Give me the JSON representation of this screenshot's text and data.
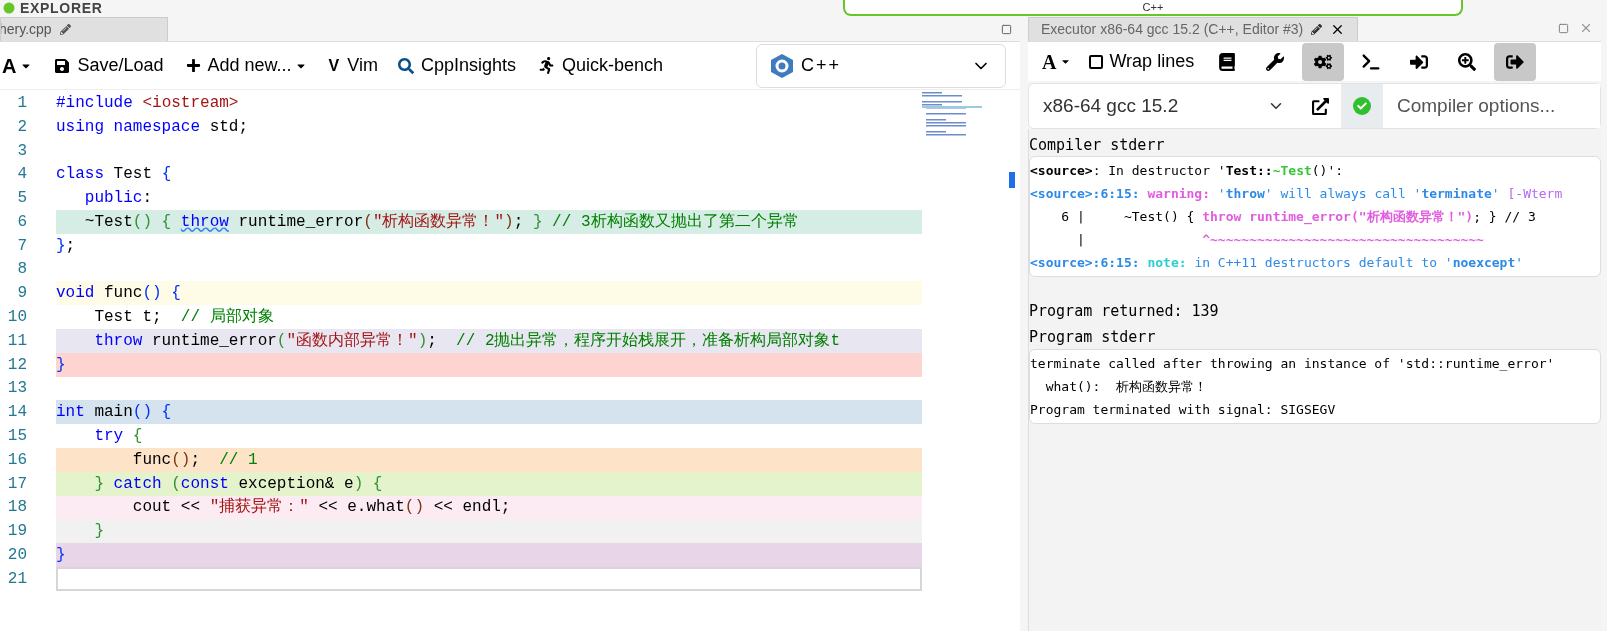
{
  "logo": {
    "text": "EXPLORER"
  },
  "top_language": {
    "text": "C++"
  },
  "editor": {
    "tab": {
      "title": "hery.cpp"
    },
    "toolbar": [
      {
        "kind": "font",
        "label": "A"
      },
      {
        "kind": "save",
        "label": "Save/Load"
      },
      {
        "kind": "add",
        "label": "Add new..."
      },
      {
        "kind": "vim",
        "icon_text": "V",
        "label": "Vim"
      },
      {
        "kind": "insights",
        "label": "CppInsights"
      },
      {
        "kind": "bench",
        "label": "Quick-bench"
      }
    ],
    "language": "C++",
    "lines": [
      {
        "number": "1",
        "color": "#ffffff",
        "current": false,
        "tokens": [
          {
            "kind": "kw",
            "text": "#include "
          },
          {
            "kind": "str",
            "text": "<iostream>"
          }
        ]
      },
      {
        "number": "2",
        "color": "#ffffff",
        "current": false,
        "tokens": [
          {
            "kind": "kw",
            "text": "using namespace "
          },
          {
            "kind": "txt",
            "text": "std;"
          }
        ]
      },
      {
        "number": "3",
        "current": false
      },
      {
        "number": "4",
        "color": "#ffffff",
        "current": false,
        "tokens": [
          {
            "kind": "kw",
            "text": "class "
          },
          {
            "kind": "txt",
            "text": "Test "
          },
          {
            "kind": "b1",
            "text": "{"
          }
        ]
      },
      {
        "number": "5",
        "color": "#ffffff",
        "current": false,
        "tokens": [
          {
            "kind": "kw",
            "text": "   public"
          },
          {
            "kind": "txt",
            "text": ":"
          }
        ]
      },
      {
        "number": "6",
        "color": "#d6ede6",
        "current": false,
        "tokens": [
          {
            "kind": "txt",
            "text": "   ~Test"
          },
          {
            "kind": "b2",
            "text": "() { "
          },
          {
            "kind": "kwerr",
            "text": "throw"
          },
          {
            "kind": "txt",
            "text": " runtime_error"
          },
          {
            "kind": "b3",
            "text": "("
          },
          {
            "kind": "str",
            "text": "\"析构函数异常！\""
          },
          {
            "kind": "b3",
            "text": ")"
          },
          {
            "kind": "txt",
            "text": "; "
          },
          {
            "kind": "b2",
            "text": "}"
          },
          {
            "kind": "cmt",
            "text": " // 3析构函数又抛出了第二个异常"
          }
        ]
      },
      {
        "number": "7",
        "color": "#ffffff",
        "current": false,
        "tokens": [
          {
            "kind": "b1",
            "text": "}"
          },
          {
            "kind": "txt",
            "text": ";"
          }
        ]
      },
      {
        "number": "8",
        "current": false
      },
      {
        "number": "9",
        "color": "#fefbe6",
        "current": false,
        "tokens": [
          {
            "kind": "kw",
            "text": "void "
          },
          {
            "kind": "txt",
            "text": "func"
          },
          {
            "kind": "b1",
            "text": "() {"
          }
        ]
      },
      {
        "number": "10",
        "color": "#ffffff",
        "current": false,
        "tokens": [
          {
            "kind": "txt",
            "text": "    Test t;  "
          },
          {
            "kind": "cmt",
            "text": "// 局部对象"
          }
        ]
      },
      {
        "number": "11",
        "color": "#e8e6f1",
        "current": false,
        "tokens": [
          {
            "kind": "kw",
            "text": "    throw "
          },
          {
            "kind": "txt",
            "text": "runtime_error"
          },
          {
            "kind": "b2",
            "text": "("
          },
          {
            "kind": "str",
            "text": "\"函数内部异常！\""
          },
          {
            "kind": "b2",
            "text": ")"
          },
          {
            "kind": "txt",
            "text": ";  "
          },
          {
            "kind": "cmt",
            "text": "// 2抛出异常，程序开始栈展开，准备析构局部对象t"
          }
        ]
      },
      {
        "number": "12",
        "color": "#fdd4d0",
        "current": false,
        "tokens": [
          {
            "kind": "b1",
            "text": "}"
          }
        ]
      },
      {
        "number": "13",
        "current": false
      },
      {
        "number": "14",
        "color": "#d4e3ee",
        "current": false,
        "tokens": [
          {
            "kind": "kw",
            "text": "int "
          },
          {
            "kind": "txt",
            "text": "main"
          },
          {
            "kind": "b1",
            "text": "() {"
          }
        ]
      },
      {
        "number": "15",
        "color": "#ffffff",
        "current": false,
        "tokens": [
          {
            "kind": "kw",
            "text": "    try "
          },
          {
            "kind": "b2",
            "text": "{"
          }
        ]
      },
      {
        "number": "16",
        "color": "#fde3c8",
        "current": false,
        "tokens": [
          {
            "kind": "txt",
            "text": "        func"
          },
          {
            "kind": "b3",
            "text": "()"
          },
          {
            "kind": "txt",
            "text": ";  "
          },
          {
            "kind": "cmt",
            "text": "// 1"
          }
        ]
      },
      {
        "number": "17",
        "color": "#e4f3cc",
        "current": false,
        "tokens": [
          {
            "kind": "b2",
            "text": "    } "
          },
          {
            "kind": "kw",
            "text": "catch "
          },
          {
            "kind": "b2",
            "text": "("
          },
          {
            "kind": "kw",
            "text": "const "
          },
          {
            "kind": "txt",
            "text": "exception& e"
          },
          {
            "kind": "b2",
            "text": ") {"
          }
        ]
      },
      {
        "number": "18",
        "color": "#fdebf3",
        "current": false,
        "tokens": [
          {
            "kind": "txt",
            "text": "        cout << "
          },
          {
            "kind": "str",
            "text": "\"捕获异常：\""
          },
          {
            "kind": "txt",
            "text": " << e.what"
          },
          {
            "kind": "b3",
            "text": "()"
          },
          {
            "kind": "txt",
            "text": " << endl;"
          }
        ]
      },
      {
        "number": "19",
        "color": "#f1f1f1",
        "current": false,
        "tokens": [
          {
            "kind": "b2",
            "text": "    }"
          }
        ]
      },
      {
        "number": "20",
        "color": "#e9d5e8",
        "current": false,
        "tokens": [
          {
            "kind": "b1",
            "text": "}"
          }
        ]
      },
      {
        "number": "21",
        "color": "#ffffff",
        "current": true
      }
    ]
  },
  "executor": {
    "tab": {
      "title": "Executor x86-64 gcc 15.2 (C++, Editor #3)"
    },
    "toolbar": [
      {
        "kind": "font",
        "label": "A",
        "selected": false
      },
      {
        "kind": "wrap",
        "label": "Wrap lines",
        "checked": false,
        "selected": false
      },
      {
        "kind": "book",
        "selected": false
      },
      {
        "kind": "wrench",
        "selected": false
      },
      {
        "kind": "gears",
        "selected": true
      },
      {
        "kind": "terminal",
        "selected": false
      },
      {
        "kind": "signin",
        "selected": false
      },
      {
        "kind": "chart",
        "selected": false
      },
      {
        "kind": "signout",
        "selected": true
      }
    ],
    "compiler": "x86-64 gcc 15.2",
    "status_ok": true,
    "options_placeholder": "Compiler options...",
    "compiler_stderr_title": "Compiler stderr",
    "compiler_stderr": [
      [
        {
          "kind": "bold",
          "text": "<source>"
        },
        {
          "kind": "txt",
          "text": ": In destructor '"
        },
        {
          "kind": "bold",
          "text": "Test::"
        },
        {
          "kind": "greenbold",
          "text": "~Test"
        },
        {
          "kind": "txt",
          "text": "()':"
        }
      ],
      [
        {
          "kind": "bluebold",
          "text": "<source>:6:15: "
        },
        {
          "kind": "warn",
          "text": "warning: "
        },
        {
          "kind": "blue",
          "text": "'"
        },
        {
          "kind": "bluebold",
          "text": "throw"
        },
        {
          "kind": "blue",
          "text": "' will always call '"
        },
        {
          "kind": "bluebold",
          "text": "terminate"
        },
        {
          "kind": "blue",
          "text": "' "
        },
        {
          "kind": "magenta",
          "text": "[-Wterm"
        }
      ],
      [
        {
          "kind": "txt",
          "text": "    6 |     ~Test() { "
        },
        {
          "kind": "warn",
          "text": "throw runtime_error(\"析构函数异常！\")"
        },
        {
          "kind": "txt",
          "text": "; } // 3"
        }
      ],
      [
        {
          "kind": "txt",
          "text": "      |               "
        },
        {
          "kind": "warn",
          "text": "^~~~~~~~~~~~~~~~~~~~~~~~~~~~~~~~~~~~"
        }
      ],
      [
        {
          "kind": "bluebold",
          "text": "<source>:6:15: "
        },
        {
          "kind": "note",
          "text": "note: "
        },
        {
          "kind": "blue",
          "text": "in C++11 destructors default to '"
        },
        {
          "kind": "bluebold",
          "text": "noexcept"
        },
        {
          "kind": "blue",
          "text": "'"
        }
      ]
    ],
    "program_returned": "Program returned: 139",
    "program_stderr_title": "Program stderr",
    "program_stderr": [
      "terminate called after throwing an instance of 'std::runtime_error'",
      "  what():  析构函数异常！",
      "Program terminated with signal: SIGSEGV"
    ]
  }
}
